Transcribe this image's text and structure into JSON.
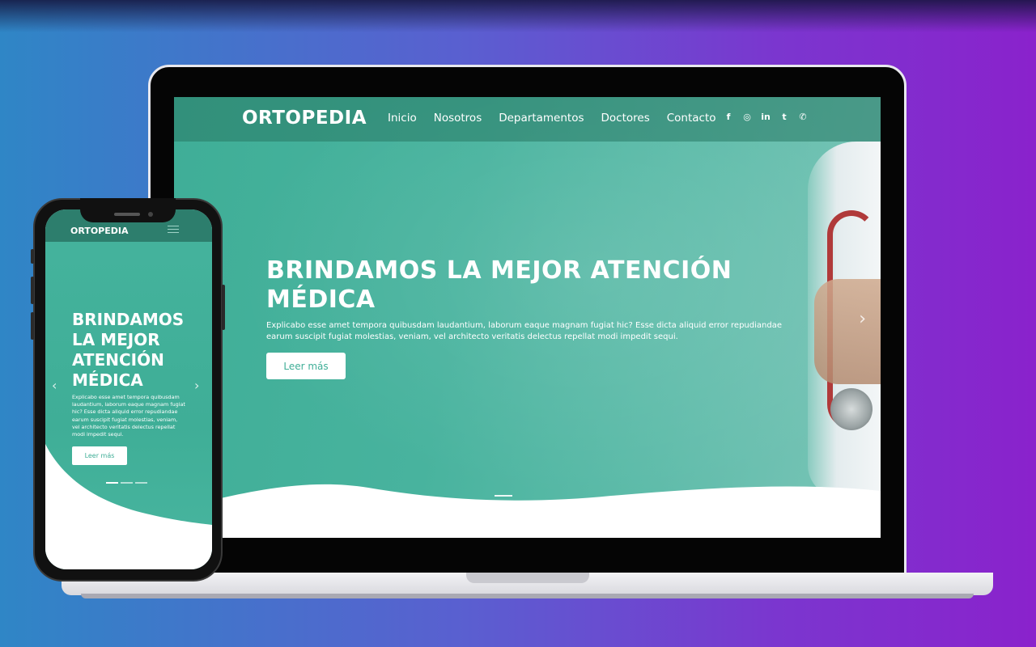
{
  "site": {
    "brand": "ORTOPEDIA",
    "nav": [
      "Inicio",
      "Nosotros",
      "Departamentos",
      "Doctores",
      "Contacto"
    ],
    "socials": [
      "facebook-icon",
      "instagram-icon",
      "linkedin-icon",
      "twitter-icon",
      "whatsapp-icon"
    ],
    "social_glyphs": [
      "f",
      "◎",
      "in",
      "t",
      "✆"
    ]
  },
  "hero": {
    "title": "BRINDAMOS LA MEJOR ATENCIÓN MÉDICA",
    "text": "Explicabo esse amet tempora quibusdam laudantium, laborum eaque magnam fugiat hic? Esse dicta aliquid error repudiandae earum suscipit fugiat molestias, veniam, vel architecto veritatis delectus repellat modi impedit sequi.",
    "button": "Leer más"
  },
  "mobile": {
    "brand": "ORTOPEDIA",
    "title": "BRINDAMOS LA MEJOR ATENCIÓN MÉDICA",
    "text": "Explicabo esse amet tempora quibusdam laudantium, laborum eaque magnam fugiat hic? Esse dicta aliquid error repudiandae earum suscipit fugiat molestias, veniam, vel architecto veritatis delectus repellat modi impedit sequi.",
    "button": "Leer más"
  },
  "colors": {
    "accent": "#3fae97",
    "nav_dark": "#2d7e6d",
    "background_start": "#2f86c6",
    "background_end": "#8a22cc"
  }
}
